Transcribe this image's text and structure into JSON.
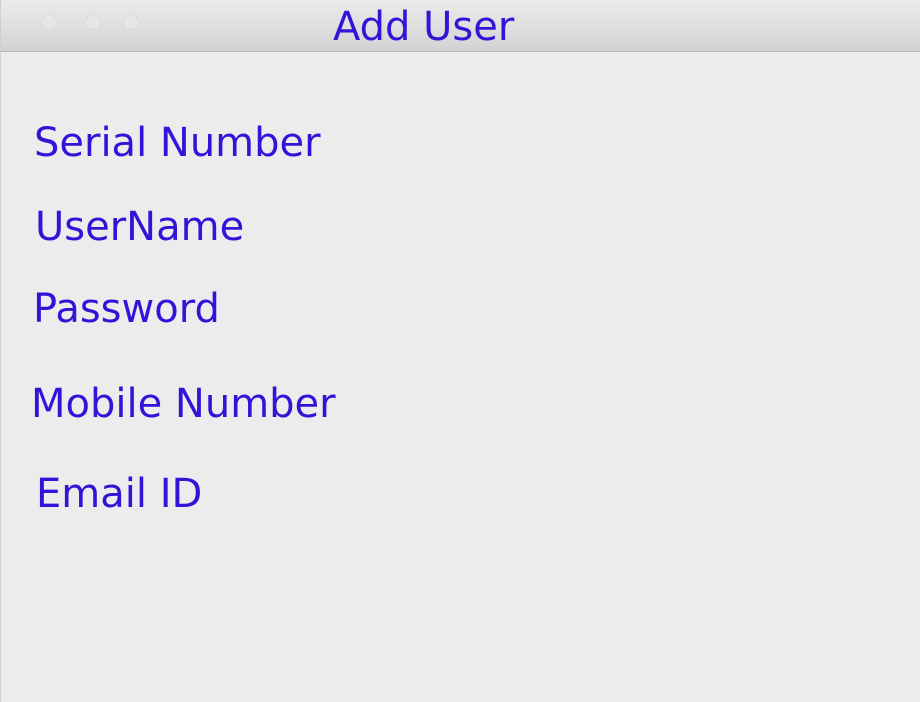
{
  "window": {
    "title": "Add User"
  },
  "form": {
    "labels": [
      "Serial Number",
      "UserName",
      "Password",
      "Mobile Number",
      "Email ID"
    ]
  },
  "colors": {
    "text": "#3512d8",
    "background": "#ececec",
    "titlebar": "#dedede"
  }
}
